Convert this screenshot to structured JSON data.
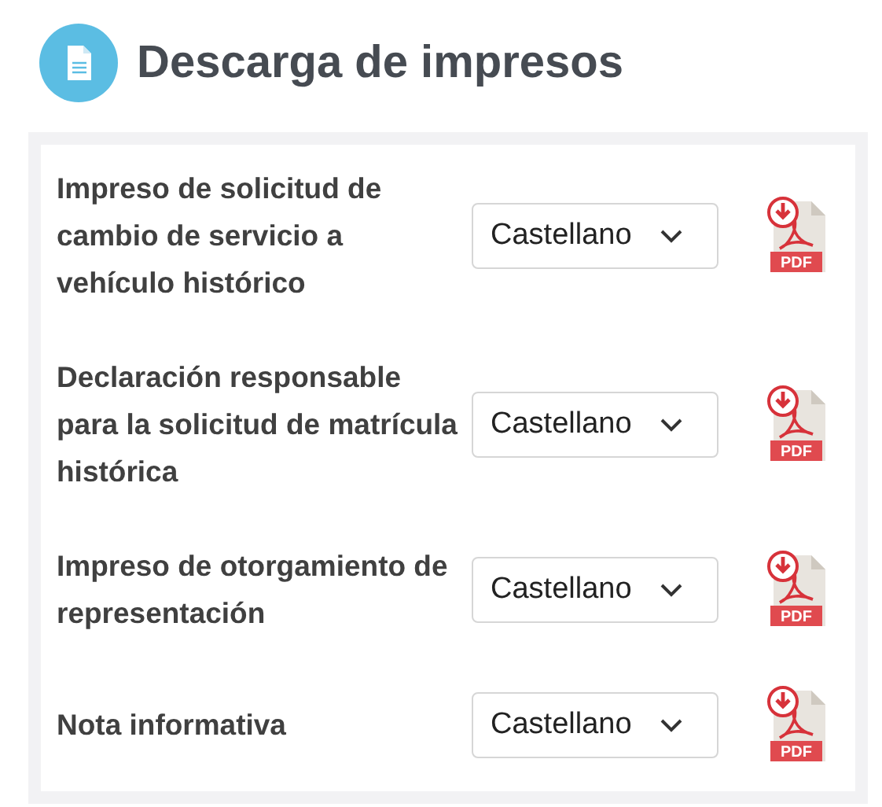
{
  "header": {
    "title": "Descarga de impresos"
  },
  "forms": [
    {
      "name": "Impreso de solicitud de cambio de servicio a vehículo histórico",
      "language": "Castellano",
      "icon_label": "PDF"
    },
    {
      "name": "Declaración responsable para la solicitud de matrícula histórica",
      "language": "Castellano",
      "icon_label": "PDF"
    },
    {
      "name": "Impreso de otorgamiento de representación",
      "language": "Castellano",
      "icon_label": "PDF"
    },
    {
      "name": "Nota informativa",
      "language": "Castellano",
      "icon_label": "PDF"
    }
  ]
}
